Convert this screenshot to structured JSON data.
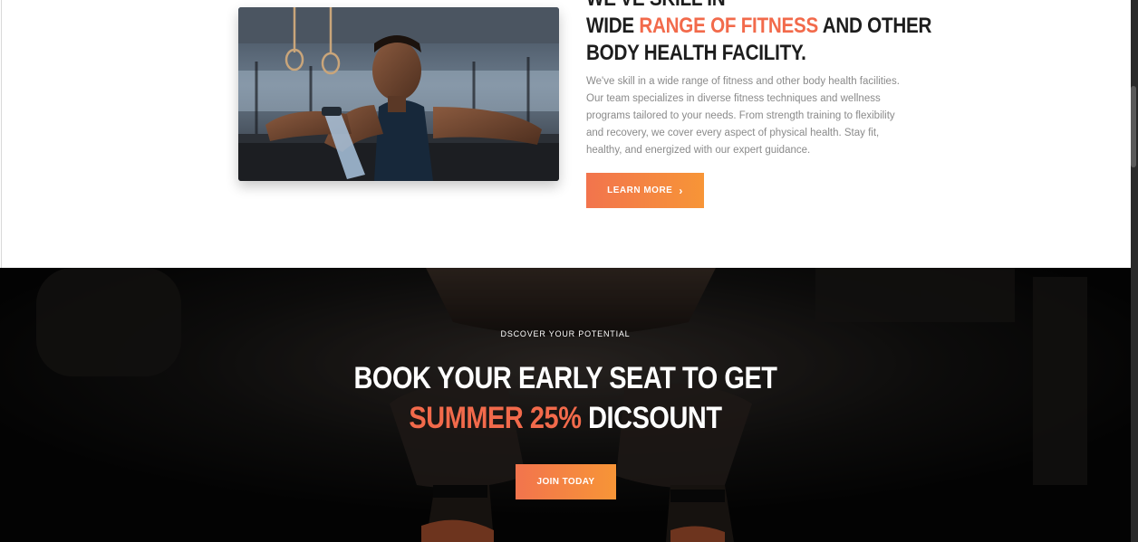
{
  "about": {
    "headline_line0": "WE'VE SKILL IN",
    "headline_prefix": "WIDE ",
    "headline_accent": "RANGE OF FITNESS",
    "headline_suffix": " AND OTHER",
    "headline_line3": "BODY HEALTH FACILITY.",
    "body": "We've skill in a wide range of fitness and other body health facilities. Our team specializes in diverse fitness techniques and wellness programs tailored to your needs. From strength training to flexibility and recovery, we cover every aspect of physical health. Stay fit, healthy, and energized with our expert guidance.",
    "button_label": "LEARN MORE",
    "button_icon": "chevron-right-icon"
  },
  "cta": {
    "eyebrow": "DSCOVER YOUR POTENTIAL",
    "title_line1": "BOOK YOUR EARLY SEAT TO GET",
    "title_accent": "SUMMER 25%",
    "title_suffix": " DICSOUNT",
    "button_label": "JOIN TODAY"
  },
  "colors": {
    "accent": "#f26a4b",
    "button_gradient_start": "#f2744d",
    "button_gradient_end": "#f79537",
    "heading": "#1d1d1d",
    "body_text": "#8a8a8a",
    "cta_background": "#0a0a0a"
  }
}
